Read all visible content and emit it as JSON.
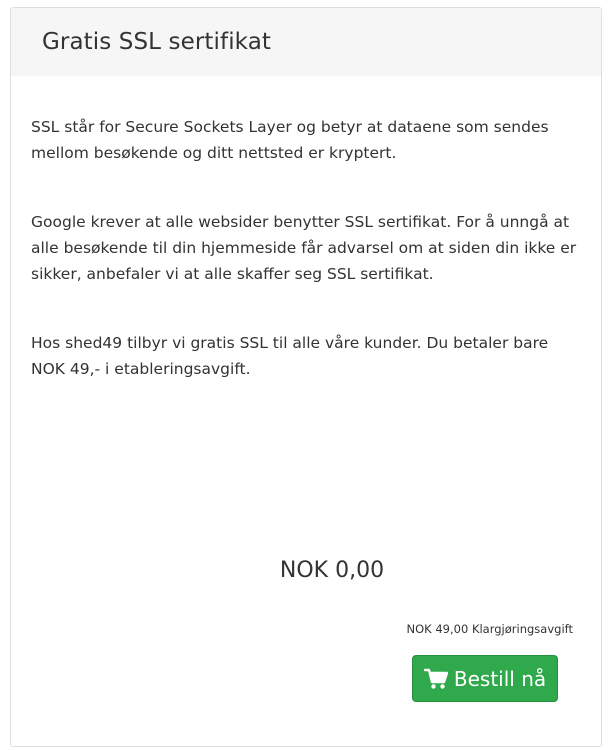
{
  "card": {
    "title": "Gratis SSL sertifikat",
    "paragraphs": [
      "SSL står for Secure Sockets Layer og betyr at dataene som sendes mellom besøkende og ditt nettsted er kryptert.",
      "Google krever at alle websider benytter SSL sertifikat. For å unngå at alle besøkende til din hjemmeside får advarsel om at siden din ikke er sikker, anbefaler vi at alle skaffer seg SSL sertifikat.",
      "Hos shed49 tilbyr vi gratis SSL til alle våre kunder. Du betaler bare NOK 49,- i etableringsavgift."
    ],
    "price": "NOK 0,00",
    "setup_fee": "NOK 49,00 Klargjøringsavgift",
    "order_button": {
      "label": "Bestill nå",
      "icon": "shopping-cart-icon"
    }
  },
  "colors": {
    "header_bg": "#f6f6f6",
    "button_bg": "#2fa94b",
    "text": "#333333"
  }
}
